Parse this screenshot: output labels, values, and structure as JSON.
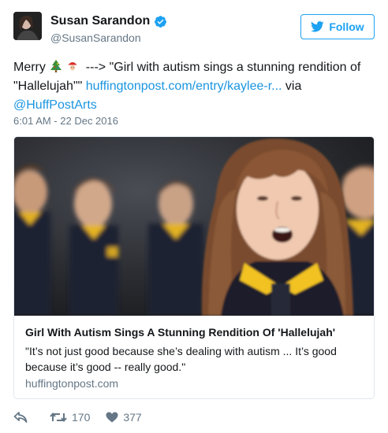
{
  "user": {
    "name": "Susan Sarandon",
    "handle": "@SusanSarandon"
  },
  "follow_button": {
    "label": "Follow"
  },
  "tweet": {
    "text_prefix": "Merry",
    "emoji": [
      "christmas-tree",
      "santa"
    ],
    "text_quote": " ---> \"Girl with autism sings a stunning rendition of \"Hallelujah\"\" ",
    "link": "huffingtonpost.com/entry/kaylee-r...",
    "text_via": " via ",
    "mention": "@HuffPostArts",
    "timestamp": "6:01 AM - 22 Dec 2016"
  },
  "card": {
    "title": "Girl With Autism Sings A Stunning Rendition Of 'Hallelujah'",
    "description": "\"It’s not just good because she’s dealing with autism ... It’s good because it’s good -- really good.\"",
    "domain": "huffingtonpost.com"
  },
  "actions": {
    "retweets": "170",
    "likes": "377"
  },
  "colors": {
    "link": "#1b95e0",
    "accent": "#1da1f2",
    "muted": "#657786",
    "border": "#e1e8ed"
  }
}
